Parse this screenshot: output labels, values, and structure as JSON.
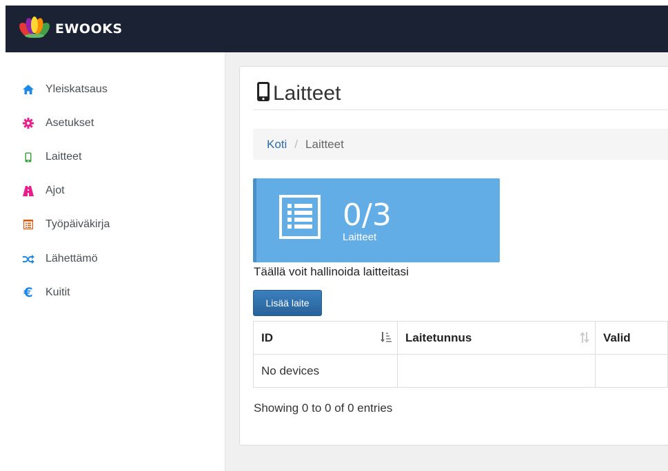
{
  "app": {
    "brand_name": "EWOOKS",
    "colors": {
      "topbar": "#1a2233",
      "accent_blue": "#63ade6",
      "button_blue": "#2f70ac",
      "link_blue": "#2c6aa6"
    }
  },
  "sidebar": {
    "items": [
      {
        "label": "Yleiskatsaus",
        "icon": "home-icon",
        "color": "#1e88e5"
      },
      {
        "label": "Asetukset",
        "icon": "gear-icon",
        "color": "#e91e8c"
      },
      {
        "label": "Laitteet",
        "icon": "mobile-phone-icon",
        "color": "#43a047"
      },
      {
        "label": "Ajot",
        "icon": "road-icon",
        "color": "#e91e8c"
      },
      {
        "label": "Työpäiväkirja",
        "icon": "list-alt-icon",
        "color": "#e65100"
      },
      {
        "label": "Lähettämö",
        "icon": "random-icon",
        "color": "#1e88e5"
      },
      {
        "label": "Kuitit",
        "icon": "euro-icon",
        "color": "#1e88e5"
      }
    ]
  },
  "page": {
    "title": "Laitteet",
    "title_icon": "mobile-phone-icon",
    "breadcrumb": {
      "home": "Koti",
      "separator": "/",
      "current": "Laitteet"
    },
    "stat": {
      "value": "0/3",
      "label": "Laitteet",
      "icon": "list-icon"
    },
    "description": "Täällä voit hallinoida laitteitasi",
    "add_button": "Lisää laite",
    "table": {
      "columns": [
        "ID",
        "Laitetunnus",
        "Valid"
      ],
      "empty_text": "No devices"
    },
    "showing": "Showing 0 to 0 of 0 entries"
  }
}
